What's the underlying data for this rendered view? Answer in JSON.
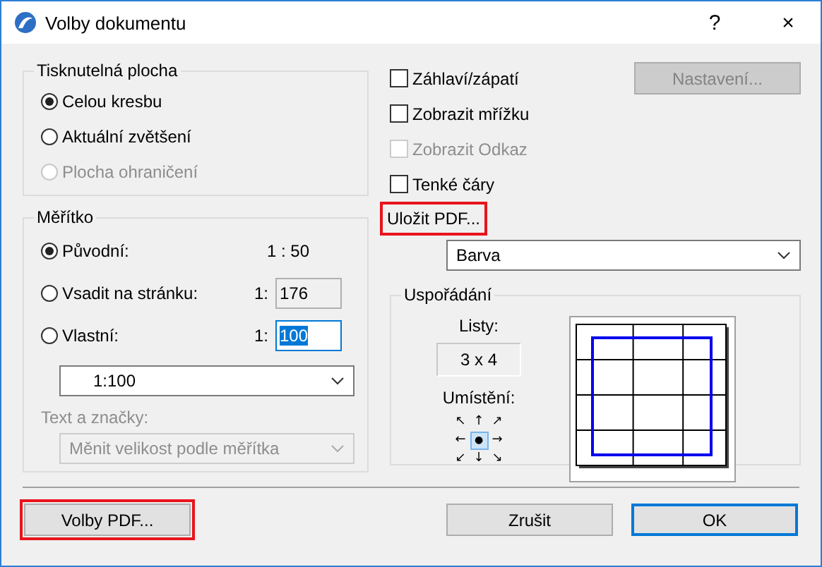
{
  "window": {
    "title": "Volby dokumentu",
    "help": "?",
    "close": "×"
  },
  "printable_area": {
    "title": "Tisknutelná plocha",
    "options": [
      {
        "label": "Celou kresbu",
        "selected": true,
        "disabled": false
      },
      {
        "label": "Aktuální zvětšení",
        "selected": false,
        "disabled": false
      },
      {
        "label": "Plocha ohraničení",
        "selected": false,
        "disabled": true
      }
    ]
  },
  "scale": {
    "title": "Měřítko",
    "options": [
      {
        "label": "Původní:",
        "selected": true,
        "kind": "reading",
        "value": "1 : 50"
      },
      {
        "label": "Vsadit na stránku:",
        "selected": false,
        "kind": "field",
        "prefix": "1:",
        "value": "176",
        "editable": false,
        "focused": false
      },
      {
        "label": "Vlastní:",
        "selected": false,
        "kind": "field",
        "prefix": "1:",
        "value": "100",
        "editable": true,
        "focused": true
      }
    ],
    "dropdown": "1:100",
    "text_marks_label": "Text a značky:",
    "text_marks_value": "Měnit velikost podle měřítka",
    "text_marks_disabled": true
  },
  "options": [
    {
      "label": "Záhlaví/zápatí",
      "checked": false,
      "disabled": false
    },
    {
      "label": "Zobrazit mřížku",
      "checked": false,
      "disabled": false
    },
    {
      "label": "Zobrazit Odkaz",
      "checked": false,
      "disabled": true
    },
    {
      "label": "Tenké čáry",
      "checked": false,
      "disabled": false
    }
  ],
  "settings_button": {
    "label": "Nastavení...",
    "disabled": true
  },
  "save_pdf": {
    "label": "Uložit PDF...",
    "highlighted": true
  },
  "color_dropdown": "Barva",
  "layout": {
    "title": "Uspořádání",
    "sheets_label": "Listy:",
    "sheets": "3 x 4",
    "placement_label": "Umístění:",
    "placement": [
      {
        "symbol": "↖",
        "selected": false
      },
      {
        "symbol": "↑",
        "selected": false
      },
      {
        "symbol": "↗",
        "selected": false
      },
      {
        "symbol": "←",
        "selected": false
      },
      {
        "symbol": "●",
        "selected": true
      },
      {
        "symbol": "→",
        "selected": false
      },
      {
        "symbol": "↙",
        "selected": false
      },
      {
        "symbol": "↓",
        "selected": false
      },
      {
        "symbol": "↘",
        "selected": false
      }
    ]
  },
  "buttons": [
    {
      "label": "Volby PDF...",
      "kind": "pdf",
      "highlighted": true,
      "default": false
    },
    {
      "label": "Zrušit",
      "kind": "cancel",
      "highlighted": false,
      "default": false
    },
    {
      "label": "OK",
      "kind": "ok",
      "highlighted": false,
      "default": true
    }
  ]
}
